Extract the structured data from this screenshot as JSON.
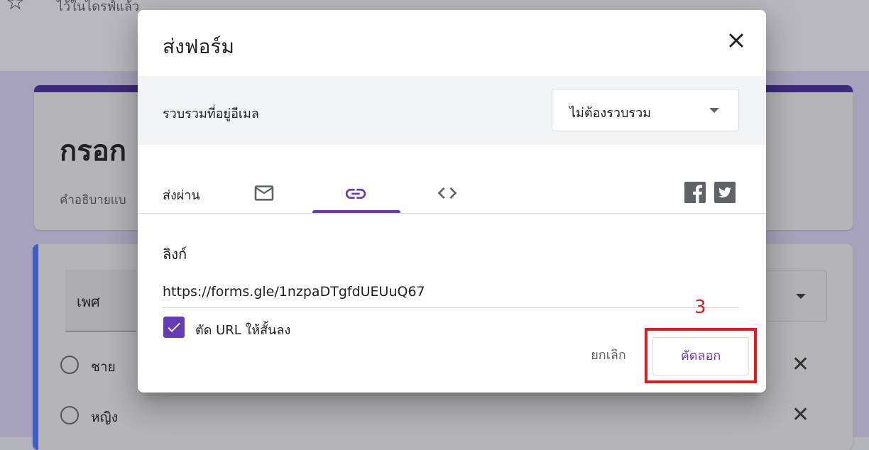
{
  "background": {
    "saved_status": "ไว้ในไดรฟ์แล้ว",
    "form_title": "กรอก",
    "form_description": "คำอธิบายแบ",
    "question_title": "เพศ",
    "options": [
      {
        "label": "ชาย"
      },
      {
        "label": "หญิง"
      }
    ]
  },
  "dialog": {
    "title": "ส่งฟอร์ม",
    "collect_email_label": "รวบรวมที่อยู่อีเมล",
    "collect_email_value": "ไม่ต้องรวบรวม",
    "send_via_label": "ส่งผ่าน",
    "tabs": [
      {
        "id": "email",
        "icon": "mail-icon"
      },
      {
        "id": "link",
        "icon": "link-icon",
        "active": true
      },
      {
        "id": "embed",
        "icon": "code-icon"
      }
    ],
    "share": [
      "facebook-icon",
      "twitter-icon"
    ],
    "link_heading": "ลิงก์",
    "link_url": "https://forms.gle/1nzpaDTgfdUEUuQ67",
    "shorten_url_label": "ตัด URL ให้สั้นลง",
    "shorten_url_checked": true,
    "cancel_label": "ยกเลิก",
    "copy_label": "คัดลอก"
  },
  "annotation": {
    "step_number": "3",
    "color": "#e21b23"
  },
  "colors": {
    "accent": "#673ab7",
    "header_bar": "#3d2a7a"
  }
}
